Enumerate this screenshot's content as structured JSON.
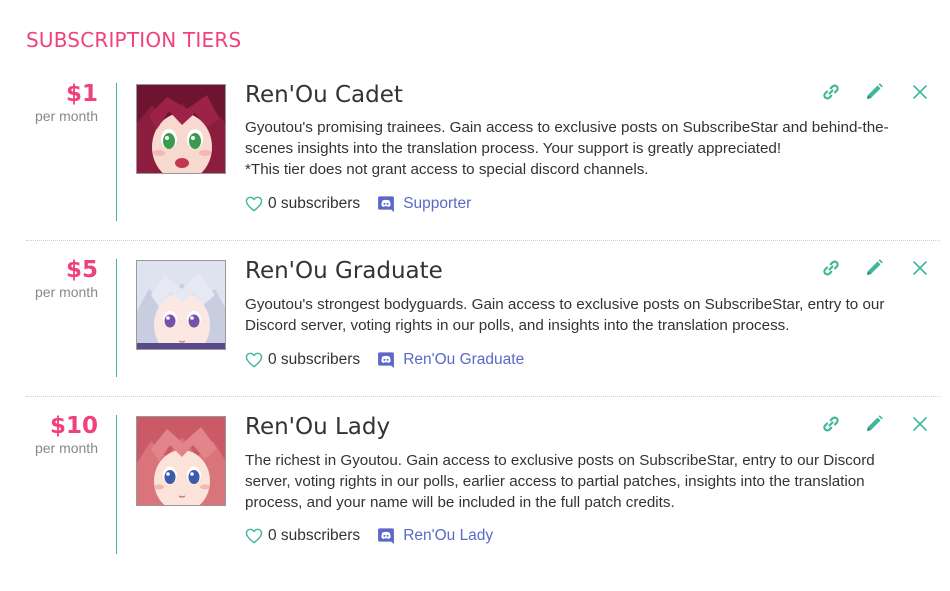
{
  "header": {
    "title": "SUBSCRIPTION TIERS"
  },
  "colors": {
    "accent": "#f0427a",
    "teal": "#3fb79a",
    "discord": "#5b68c9"
  },
  "tiers": [
    {
      "price": "$1",
      "period": "per month",
      "name": "Ren'Ou Cadet",
      "description": "Gyoutou's promising trainees. Gain access to exclusive posts on SubscribeStar and behind-the-\nscenes insights into the translation process. Your support is greatly appreciated!\n*This tier does not grant access to special discord channels.",
      "subscribers": "0 subscribers",
      "discord_role": "Supporter",
      "avatar": "anime-girl-red-hair-green-eyes"
    },
    {
      "price": "$5",
      "period": "per month",
      "name": "Ren'Ou Graduate",
      "description": "Gyoutou's strongest bodyguards. Gain access to exclusive posts on SubscribeStar, entry to our\nDiscord server, voting rights in our polls, and insights into the translation process.",
      "subscribers": "0 subscribers",
      "discord_role": "Ren'Ou Graduate",
      "avatar": "anime-girl-silver-hair-purple-eyes"
    },
    {
      "price": "$10",
      "period": "per month",
      "name": "Ren'Ou Lady",
      "description": "The richest in Gyoutou. Gain access to exclusive posts on SubscribeStar, entry to our Discord\nserver, voting rights in our polls, earlier access to partial patches, insights into the translation\nprocess, and your name will be included in the full patch credits.",
      "subscribers": "0 subscribers",
      "discord_role": "Ren'Ou Lady",
      "avatar": "anime-girl-pink-hair-blue-eyes"
    }
  ]
}
